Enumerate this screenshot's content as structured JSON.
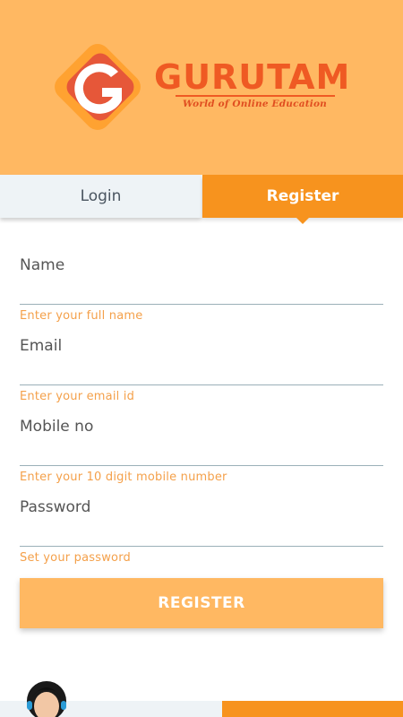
{
  "header": {
    "brand_name": "GURUTAM",
    "tagline": "World of Online Education",
    "logo_letter": "G"
  },
  "tabs": [
    {
      "label": "Login",
      "active": false
    },
    {
      "label": "Register",
      "active": true
    }
  ],
  "form": {
    "fields": [
      {
        "label": "Name",
        "hint": "Enter your full name",
        "value": ""
      },
      {
        "label": "Email",
        "hint": "Enter your email id",
        "value": ""
      },
      {
        "label": "Mobile no",
        "hint": "Enter your 10 digit mobile number",
        "value": ""
      },
      {
        "label": "Password",
        "hint": "Set your password",
        "value": ""
      }
    ],
    "submit_label": "REGISTER"
  },
  "colors": {
    "header_bg": "#ffb862",
    "accent": "#f7931e",
    "brand": "#ef5a23",
    "hint": "#f4a04a"
  },
  "icons": {
    "logo": "gurutam-logo-icon",
    "support": "support-agent-avatar-icon"
  }
}
